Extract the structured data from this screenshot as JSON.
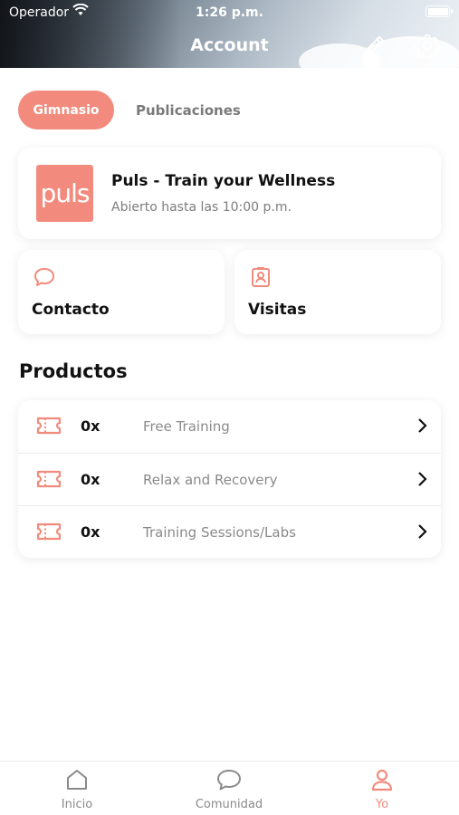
{
  "status_bar": {
    "carrier": "Operador",
    "time": "1:26 p.m."
  },
  "header": {
    "title": "Account",
    "edit_icon": "pencil-icon",
    "settings_icon": "gear-icon"
  },
  "tabs": [
    {
      "label": "Gimnasio",
      "active": true
    },
    {
      "label": "Publicaciones",
      "active": false
    }
  ],
  "gym": {
    "logo_text": "puls",
    "name": "Puls - Train your Wellness",
    "hours": "Abierto hasta las 10:00 p.m."
  },
  "quick_actions": [
    {
      "label": "Contacto",
      "icon": "chat-bubble-icon"
    },
    {
      "label": "Visitas",
      "icon": "badge-icon"
    }
  ],
  "products": {
    "title": "Productos",
    "items": [
      {
        "qty": "0x",
        "name": "Free Training"
      },
      {
        "qty": "0x",
        "name": "Relax and Recovery"
      },
      {
        "qty": "0x",
        "name": "Training Sessions/Labs"
      }
    ]
  },
  "bottom_nav": [
    {
      "label": "Inicio",
      "icon": "home-icon"
    },
    {
      "label": "Comunidad",
      "icon": "chat-bubble-icon"
    },
    {
      "label": "Yo",
      "icon": "person-icon",
      "active": true
    }
  ],
  "colors": {
    "accent": "#f28b7d"
  }
}
